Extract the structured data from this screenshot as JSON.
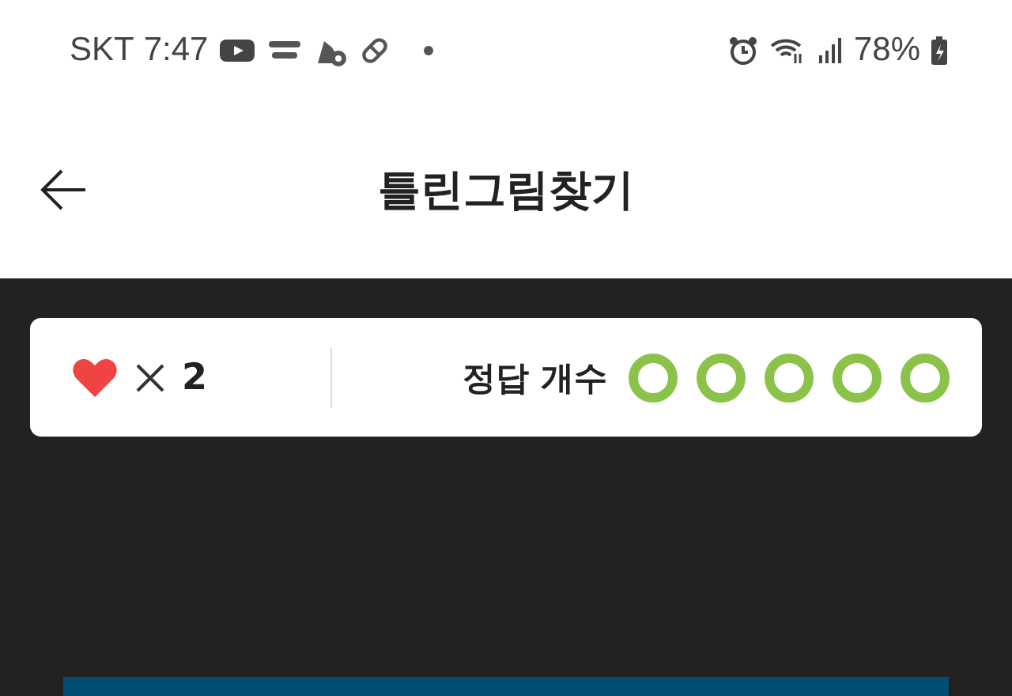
{
  "status_bar": {
    "carrier": "SKT",
    "time": "7:47",
    "battery": "78%"
  },
  "header": {
    "title": "틀린그림찾기"
  },
  "score_card": {
    "lives": "2",
    "answers_label": "정답 개수",
    "answers": [
      {
        "found": false
      },
      {
        "found": false
      },
      {
        "found": false
      },
      {
        "found": false
      },
      {
        "found": false
      }
    ]
  }
}
